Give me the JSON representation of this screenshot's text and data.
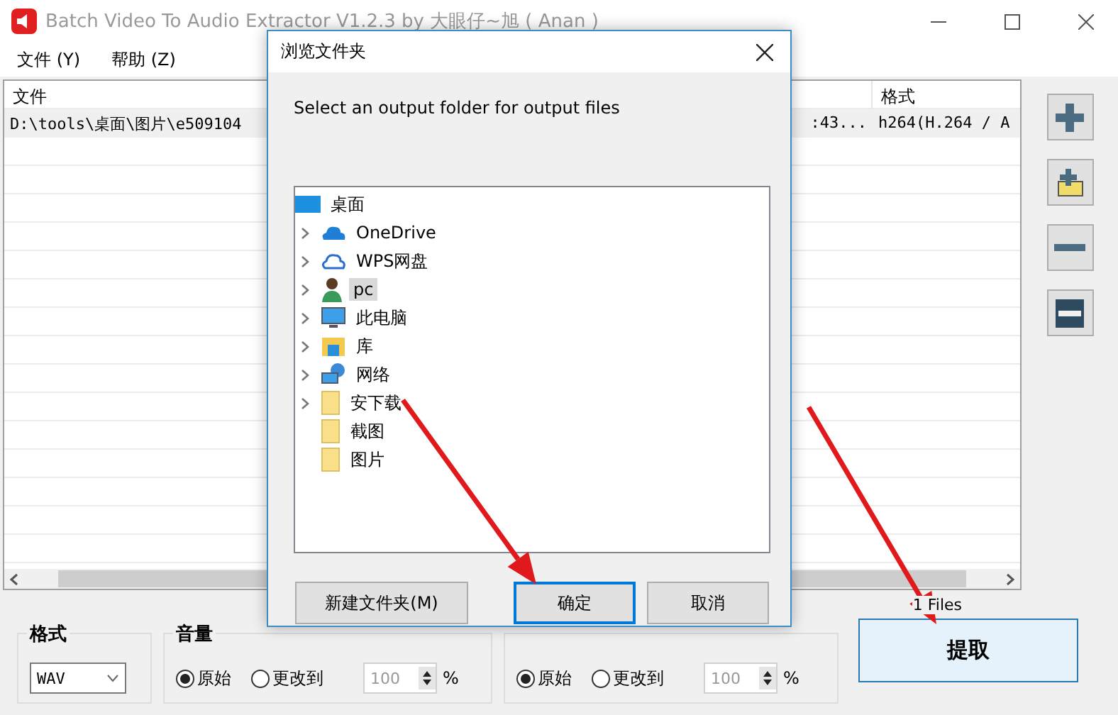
{
  "window": {
    "title": "Batch Video To Audio Extractor V1.2.3 by 大眼仔~旭 ( Anan )"
  },
  "menu": [
    {
      "label": "文件 (Y)"
    },
    {
      "label": "帮助 (Z)"
    }
  ],
  "table": {
    "columns": [
      "文件",
      "",
      "格式"
    ],
    "rows": [
      [
        "D:\\tools\\桌面\\图片\\e509104",
        ":43...",
        "h264(H.264 / A"
      ]
    ]
  },
  "side_buttons": [
    {
      "kind": "add"
    },
    {
      "kind": "add-folder"
    },
    {
      "kind": "remove"
    },
    {
      "kind": "clear"
    }
  ],
  "file_count": "1 Files",
  "format_group": {
    "title": "格式",
    "value": "WAV"
  },
  "volume_groups": [
    {
      "title": "音量",
      "options": [
        {
          "label": "原始",
          "selected": true
        },
        {
          "label": "更改到",
          "selected": false
        }
      ],
      "value": "100",
      "value_disabled": true,
      "unit": "%"
    },
    {
      "options": [
        {
          "label": "原始",
          "selected": true
        },
        {
          "label": "更改到",
          "selected": false
        }
      ],
      "value": "100",
      "value_disabled": true,
      "unit": "%"
    }
  ],
  "extract_button": "提取",
  "dialog": {
    "title": "浏览文件夹",
    "prompt": "Select an output folder for output files",
    "tree": [
      {
        "label": "桌面",
        "kind": "desktop",
        "selected": false,
        "children": [
          {
            "label": "OneDrive",
            "kind": "cloud",
            "expandable": true,
            "selected": false
          },
          {
            "label": "WPS网盘",
            "kind": "cloud-outline",
            "expandable": true,
            "selected": false
          },
          {
            "label": "pc",
            "kind": "user",
            "expandable": true,
            "selected": true
          },
          {
            "label": "此电脑",
            "kind": "computer",
            "expandable": true,
            "selected": false
          },
          {
            "label": "库",
            "kind": "library",
            "expandable": true,
            "selected": false
          },
          {
            "label": "网络",
            "kind": "network",
            "expandable": true,
            "selected": false
          },
          {
            "label": "安下载",
            "kind": "folder",
            "expandable": true,
            "selected": false
          },
          {
            "label": "截图",
            "kind": "folder",
            "expandable": false,
            "selected": false
          },
          {
            "label": "图片",
            "kind": "folder",
            "expandable": false,
            "selected": false
          }
        ]
      }
    ],
    "buttons": [
      {
        "label": "新建文件夹(M)",
        "default": false
      },
      {
        "label": "确定",
        "default": true
      },
      {
        "label": "取消",
        "default": false
      }
    ]
  }
}
